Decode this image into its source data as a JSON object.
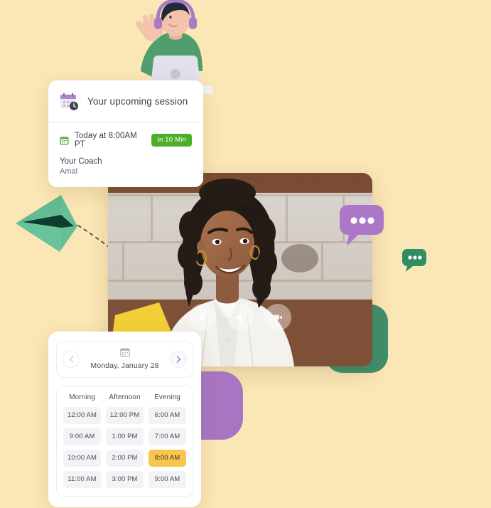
{
  "theme": {
    "background": "#fbe6b5",
    "accent_purple": "#a875c3",
    "accent_green": "#3f8f6d",
    "badge_green": "#4caf28",
    "selected_slot": "#f7c64e"
  },
  "session_card": {
    "icon": "calendar-clock-icon",
    "title": "Your upcoming session",
    "when_icon": "calendar-icon",
    "when": "Today at 8:00AM PT",
    "badge": "In 10 Min",
    "coach_label": "Your Coach",
    "coach_name": "Amal"
  },
  "video_window": {
    "traffic_lights": [
      "red",
      "yellow",
      "green"
    ],
    "controls": [
      {
        "name": "microphone-button",
        "icon": "microphone-icon"
      },
      {
        "name": "speaker-button",
        "icon": "speaker-icon"
      },
      {
        "name": "camera-button",
        "icon": "video-camera-icon"
      }
    ]
  },
  "chat_bubbles": [
    {
      "name": "chat-bubble-large",
      "color": "#a875c3",
      "dots": 3
    },
    {
      "name": "chat-bubble-small",
      "color": "#3f8f6d",
      "dots": 3
    }
  ],
  "scheduler": {
    "prev_label": "‹",
    "next_label": "›",
    "date_icon": "calendar-icon",
    "date": "Monday, January 28",
    "columns": [
      "Morning",
      "Afternoon",
      "Evening"
    ],
    "rows": [
      [
        "12:00 AM",
        "12:00 PM",
        "6:00 AM"
      ],
      [
        "9:00 AM",
        "1:00 PM",
        "7:00 AM"
      ],
      [
        "10:00 AM",
        "2:00 PM",
        "8:00 AM"
      ],
      [
        "11:00 AM",
        "3:00 PM",
        "9:00 AM"
      ]
    ],
    "selected": {
      "row": 2,
      "col": 2,
      "value": "8:00 AM"
    }
  },
  "illustration": {
    "name": "person-with-headphones-waving",
    "laptop": "laptop-icon",
    "paper_plane": "paper-plane-icon"
  }
}
